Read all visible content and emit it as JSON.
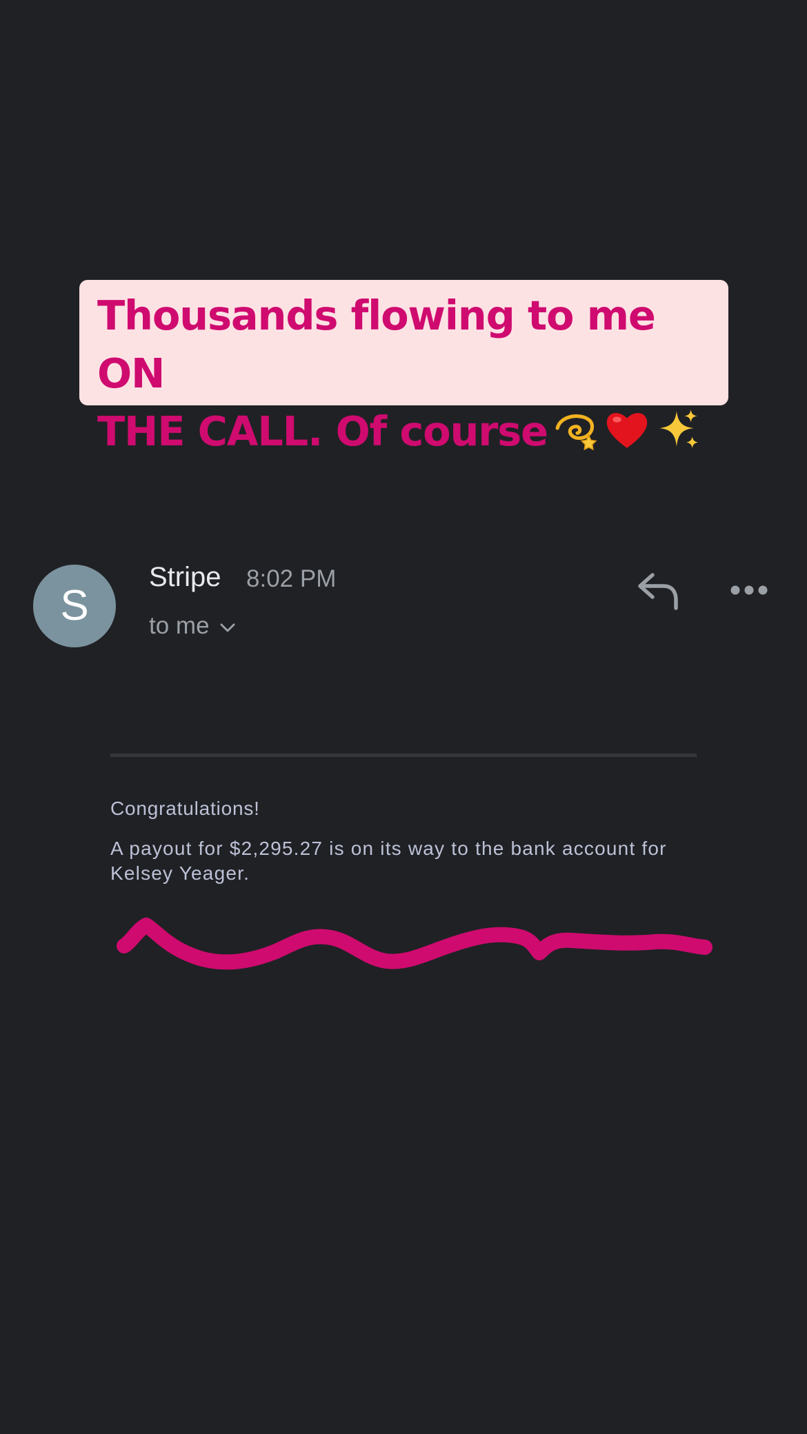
{
  "caption": {
    "text": "Thousands flowing to me ON\nTHE CALL. Of course",
    "emojis": [
      "dizzy-icon",
      "red-heart-icon",
      "sparkles-icon"
    ]
  },
  "email": {
    "avatar_letter": "S",
    "sender": "Stripe",
    "time": "8:02 PM",
    "recipient": "to me",
    "actions": [
      "reply-icon",
      "more-options-icon"
    ]
  },
  "message": {
    "greeting": "Congratulations!",
    "body": "A payout for $2,295.27 is on its way to the bank account for Kelsey Yeager."
  },
  "colors": {
    "background": "#202125",
    "caption_bg": "#fde2e4",
    "caption_text": "#cf0b6f",
    "avatar": "#7b939e",
    "scribble": "#cf0b6f"
  }
}
